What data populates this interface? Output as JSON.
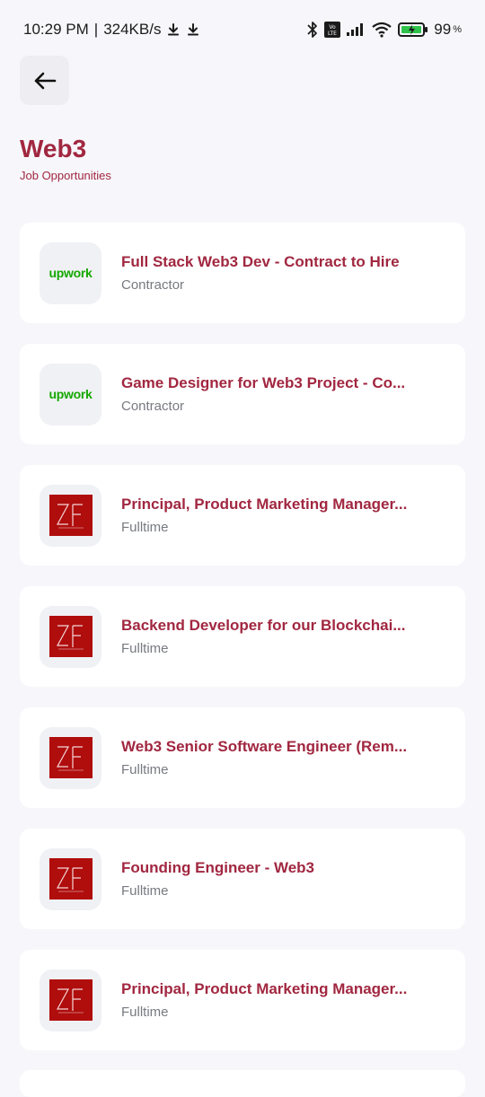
{
  "status_bar": {
    "time": "10:29 PM",
    "separator": "|",
    "speed": "324KB/s",
    "battery": "99",
    "battery_unit": "%",
    "volte": "Vo LTE"
  },
  "header": {
    "title": "Web3",
    "subtitle": "Job Opportunities"
  },
  "jobs": [
    {
      "title": "Full Stack Web3 Dev - Contract to Hire",
      "type": "Contractor",
      "logo": "upwork"
    },
    {
      "title": "Game Designer for Web3 Project - Co...",
      "type": "Contractor",
      "logo": "upwork"
    },
    {
      "title": "Principal, Product Marketing Manager...",
      "type": "Fulltime",
      "logo": "zf"
    },
    {
      "title": "Backend Developer for our Blockchai...",
      "type": "Fulltime",
      "logo": "zf"
    },
    {
      "title": "Web3 Senior Software Engineer (Rem...",
      "type": "Fulltime",
      "logo": "zf"
    },
    {
      "title": "Founding Engineer - Web3",
      "type": "Fulltime",
      "logo": "zf"
    },
    {
      "title": "Principal, Product Marketing Manager...",
      "type": "Fulltime",
      "logo": "zf"
    }
  ],
  "logos": {
    "upwork_text": "upwork",
    "zf_text": "ZF"
  },
  "colors": {
    "accent": "#a12740",
    "upwork_green": "#14a800",
    "zf_red": "#b00d0d",
    "background": "#f7f7fb"
  }
}
